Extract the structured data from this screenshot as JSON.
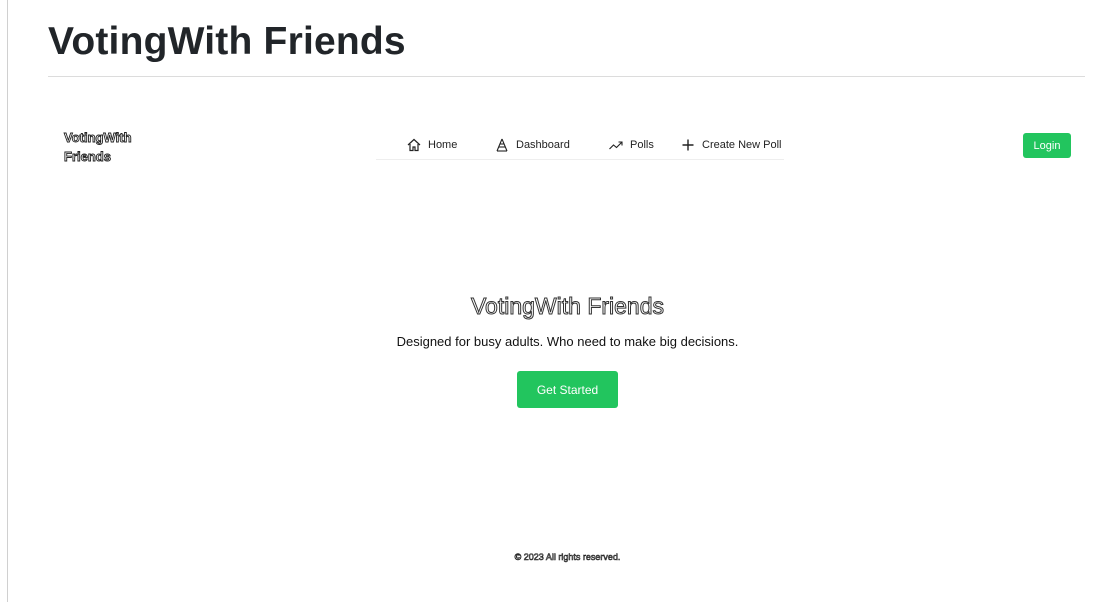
{
  "document": {
    "title": "VotingWith Friends"
  },
  "navbar": {
    "brand": "VotingWith Friends",
    "items": [
      {
        "label": "Home",
        "icon": "home-icon"
      },
      {
        "label": "Dashboard",
        "icon": "dashboard-icon"
      },
      {
        "label": "Polls",
        "icon": "polls-icon"
      },
      {
        "label": "Create New Poll",
        "icon": "plus-icon"
      }
    ],
    "login_label": "Login"
  },
  "hero": {
    "title": "VotingWith Friends",
    "subtitle": "Designed for busy adults. Who need to make big decisions.",
    "cta_label": "Get Started"
  },
  "footer": {
    "text": "© 2023 All rights reserved."
  },
  "colors": {
    "accent": "#22c55e",
    "text": "#212529",
    "divider": "#dcdcdc"
  }
}
